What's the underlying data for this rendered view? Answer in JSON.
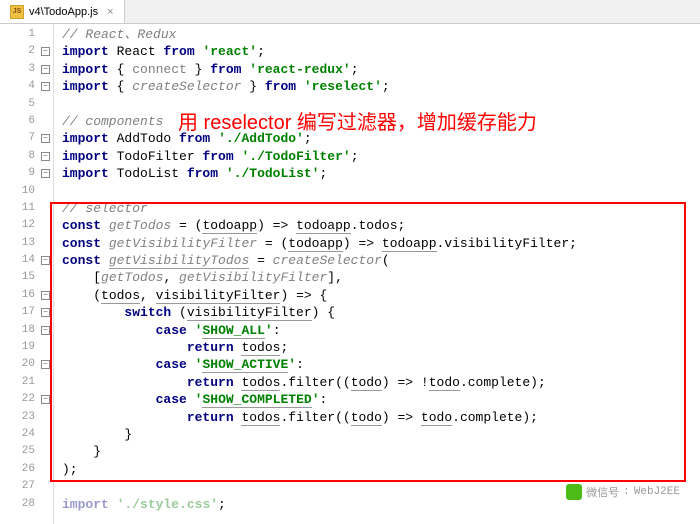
{
  "tab": {
    "filename": "v4\\TodoApp.js",
    "icon_label": "JS"
  },
  "annotation": {
    "text": "用 reselector 编写过滤器，增加缓存能力"
  },
  "watermark": {
    "label": "微信号",
    "value": "WebJ2EE"
  },
  "lines": [
    {
      "n": 1,
      "html": "<span class='cm'>// React、Redux</span>"
    },
    {
      "n": 2,
      "fold": true,
      "html": "<span class='kw'>import</span> React <span class='kw'>from</span> <span class='str'>'react'</span>;"
    },
    {
      "n": 3,
      "fold": true,
      "html": "<span class='kw'>import</span> { <span class='cm' style='font-style:normal'>connect</span> } <span class='kw'>from</span> <span class='str'>'react-redux'</span>;"
    },
    {
      "n": 4,
      "fold": true,
      "html": "<span class='kw'>import</span> { <span class='cm'>createSelector</span> } <span class='kw'>from</span> <span class='str'>'reselect'</span>;"
    },
    {
      "n": 5,
      "html": ""
    },
    {
      "n": 6,
      "html": "<span class='cm'>// components</span>"
    },
    {
      "n": 7,
      "fold": true,
      "html": "<span class='kw'>import</span> AddTodo <span class='kw'>from</span> <span class='str'>'./AddTodo'</span>;"
    },
    {
      "n": 8,
      "fold": true,
      "html": "<span class='kw'>import</span> TodoFilter <span class='kw'>from</span> <span class='str'>'./TodoFilter'</span>;"
    },
    {
      "n": 9,
      "fold": true,
      "html": "<span class='kw'>import</span> TodoList <span class='kw'>from</span> <span class='str'>'./TodoList'</span>;"
    },
    {
      "n": 10,
      "html": ""
    },
    {
      "n": 11,
      "html": "<span class='cm'>// selector</span>"
    },
    {
      "n": 12,
      "html": "<span class='kw'>const</span> <span class='cm' style='font-style:italic'>getTodos</span> = (<span class='id-u'>todoapp</span>) =&gt; <span class='id-u'>todoapp</span>.todos;"
    },
    {
      "n": 13,
      "html": "<span class='kw'>const</span> <span class='cm' style='font-style:italic'>getVisibilityFilter</span> = (<span class='id-u'>todoapp</span>) =&gt; <span class='id-u'>todoapp</span>.visibilityFilter;"
    },
    {
      "n": 14,
      "fold": true,
      "html": "<span class='kw'>const</span> <span class='cm id-u' style='font-style:italic'>getVisibilityTodos</span> = <span class='cm' style='font-style:italic'>createSelector</span>("
    },
    {
      "n": 15,
      "html": "    [<span class='cm' style='font-style:italic'>getTodos</span>, <span class='cm' style='font-style:italic'>getVisibilityFilter</span>],"
    },
    {
      "n": 16,
      "fold": true,
      "html": "    (<span class='id-u'>todos</span>, <span class='id-u'>visibilityFilter</span>) =&gt; {"
    },
    {
      "n": 17,
      "fold": true,
      "html": "        <span class='kw'>switch</span> (<span class='id-u'>visibilityFilter</span>) {"
    },
    {
      "n": 18,
      "fold": true,
      "html": "            <span class='kw'>case</span> <span class='str'>'<span class='id-u'>SHOW_ALL</span>'</span>:"
    },
    {
      "n": 19,
      "html": "                <span class='kw'>return</span> <span class='id-u'>todos</span>;"
    },
    {
      "n": 20,
      "fold": true,
      "html": "            <span class='kw'>case</span> <span class='str'>'<span class='id-u'>SHOW_ACTIVE</span>'</span>:"
    },
    {
      "n": 21,
      "html": "                <span class='kw'>return</span> <span class='id-u'>todos</span>.filter((<span class='id-u'>todo</span>) =&gt; !<span class='id-u'>todo</span>.complete);"
    },
    {
      "n": 22,
      "fold": true,
      "html": "            <span class='kw'>case</span> <span class='str'>'<span class='id-u'>SHOW_COMPLETED</span>'</span>:"
    },
    {
      "n": 23,
      "html": "                <span class='kw'>return</span> <span class='id-u'>todos</span>.filter((<span class='id-u'>todo</span>) =&gt; <span class='id-u'>todo</span>.complete);"
    },
    {
      "n": 24,
      "html": "        }"
    },
    {
      "n": 25,
      "html": "    }"
    },
    {
      "n": 26,
      "html": ");"
    },
    {
      "n": 27,
      "html": ""
    },
    {
      "n": 28,
      "html": "<span class='kw' style='opacity:.4'>import</span> <span class='str' style='opacity:.4'>'./style.css'</span>;"
    }
  ]
}
